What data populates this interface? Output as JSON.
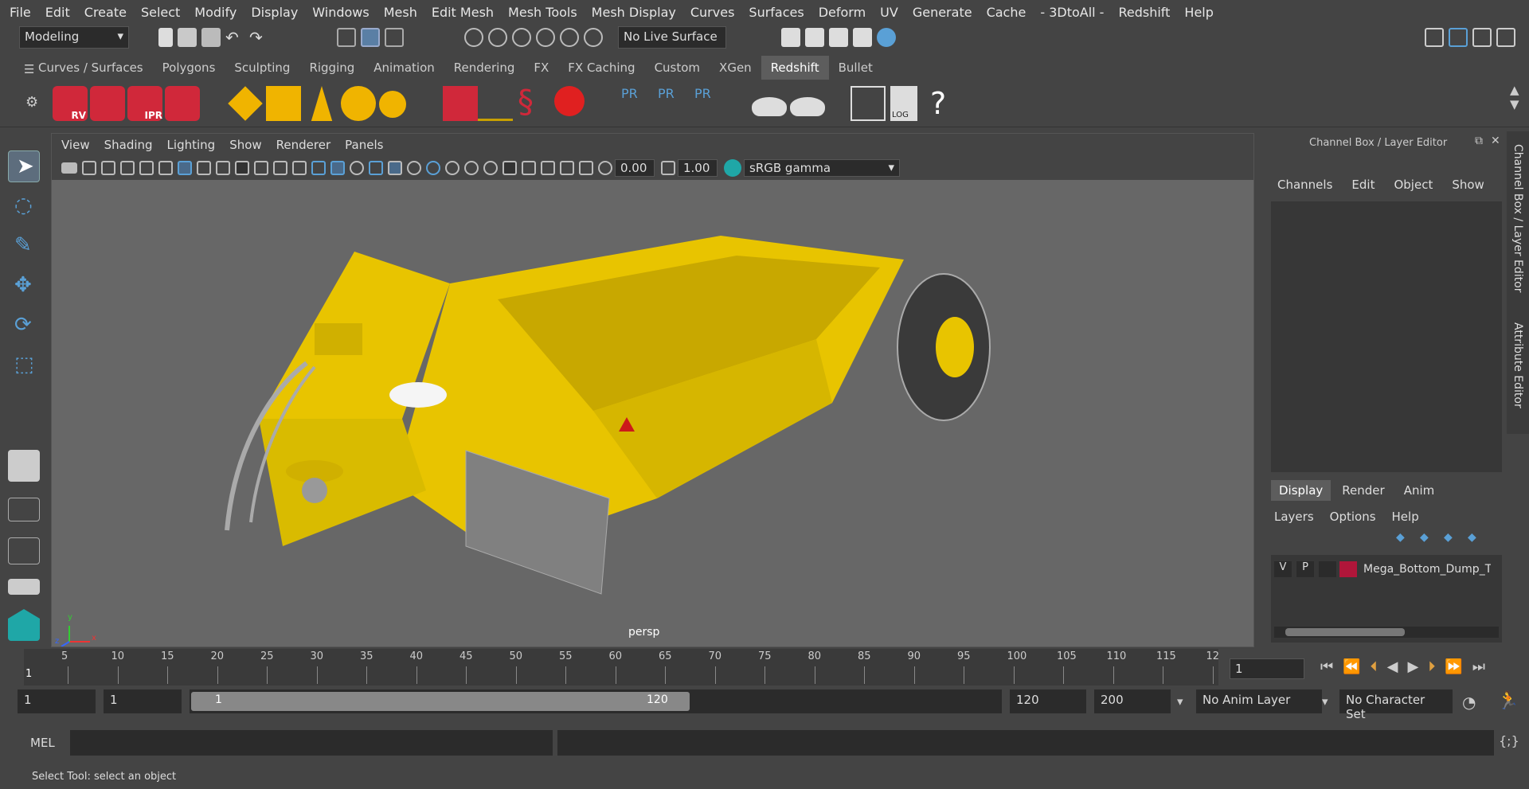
{
  "menubar": {
    "items": [
      "File",
      "Edit",
      "Create",
      "Select",
      "Modify",
      "Display",
      "Windows",
      "Mesh",
      "Edit Mesh",
      "Mesh Tools",
      "Mesh Display",
      "Curves",
      "Surfaces",
      "Deform",
      "UV",
      "Generate",
      "Cache",
      "- 3DtoAll -",
      "Redshift",
      "Help"
    ]
  },
  "statusline": {
    "workspace": "Modeling",
    "live_surface": "No Live Surface"
  },
  "shelf": {
    "tabs": [
      "Curves / Surfaces",
      "Polygons",
      "Sculpting",
      "Rigging",
      "Animation",
      "Rendering",
      "FX",
      "FX Caching",
      "Custom",
      "XGen",
      "Redshift",
      "Bullet"
    ],
    "active_tab": "Redshift",
    "icon_labels": [
      "RV",
      "IPR",
      "PR",
      "PR",
      "PR",
      "LOG",
      "?"
    ]
  },
  "viewport": {
    "menu": [
      "View",
      "Shading",
      "Lighting",
      "Show",
      "Renderer",
      "Panels"
    ],
    "exposure": "0.00",
    "gamma": "1.00",
    "color_space": "sRGB gamma",
    "camera_label": "persp",
    "axis": {
      "x": "x",
      "y": "y",
      "z": "z"
    }
  },
  "channelbox": {
    "title": "Channel Box / Layer Editor",
    "menu": [
      "Channels",
      "Edit",
      "Object",
      "Show"
    ],
    "layer_tabs": [
      "Display",
      "Render",
      "Anim"
    ],
    "active_layer_tab": "Display",
    "layer_menu": [
      "Layers",
      "Options",
      "Help"
    ],
    "layer": {
      "v": "V",
      "p": "P",
      "name": "Mega_Bottom_Dump_T",
      "color": "#b0163a"
    }
  },
  "sidetabs": [
    "Channel Box / Layer Editor",
    "Attribute Editor"
  ],
  "timeline": {
    "ticks": [
      "5",
      "10",
      "15",
      "20",
      "25",
      "30",
      "35",
      "40",
      "45",
      "50",
      "55",
      "60",
      "65",
      "70",
      "75",
      "80",
      "85",
      "90",
      "95",
      "100",
      "105",
      "110",
      "115",
      "12"
    ],
    "current_marker": "1",
    "current_frame": "1"
  },
  "range": {
    "start": "1",
    "inner_start": "1",
    "slider_start": "1",
    "slider_end": "120",
    "inner_end": "120",
    "end": "200",
    "anim_layer": "No Anim Layer",
    "character_set": "No Character Set"
  },
  "mel": {
    "label": "MEL"
  },
  "help": {
    "text": "Select Tool: select an object"
  },
  "colors": {
    "accent": "#5aa0d6",
    "model_yellow": "#e8c400",
    "redshift_red": "#d0283a"
  }
}
